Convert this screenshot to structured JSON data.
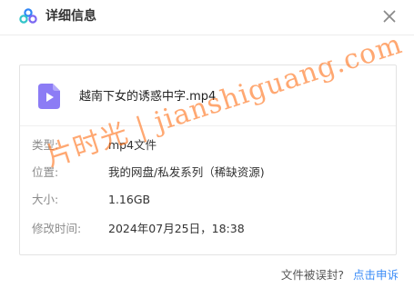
{
  "header": {
    "title": "详细信息",
    "logo_icon": "cloud-logo-icon",
    "close_icon": "close-icon"
  },
  "file": {
    "name": "越南下女的诱惑中字.mp4",
    "icon": "video-file-icon",
    "icon_color": "#8c7cf5"
  },
  "details": [
    {
      "label": "类型:",
      "value": "mp4文件"
    },
    {
      "label": "位置:",
      "value": "我的网盘/私发系列（稀缺资源)"
    },
    {
      "label": "大小:",
      "value": "1.16GB"
    },
    {
      "label": "修改时间:",
      "value": "2024年07月25日，18:38"
    }
  ],
  "footer": {
    "question": "文件被误封?",
    "appeal_link": "点击申诉",
    "link_color": "#3b8cf7"
  },
  "watermark": {
    "text": "片时光 | jianshiguang.com",
    "color": "#ff6e14"
  }
}
